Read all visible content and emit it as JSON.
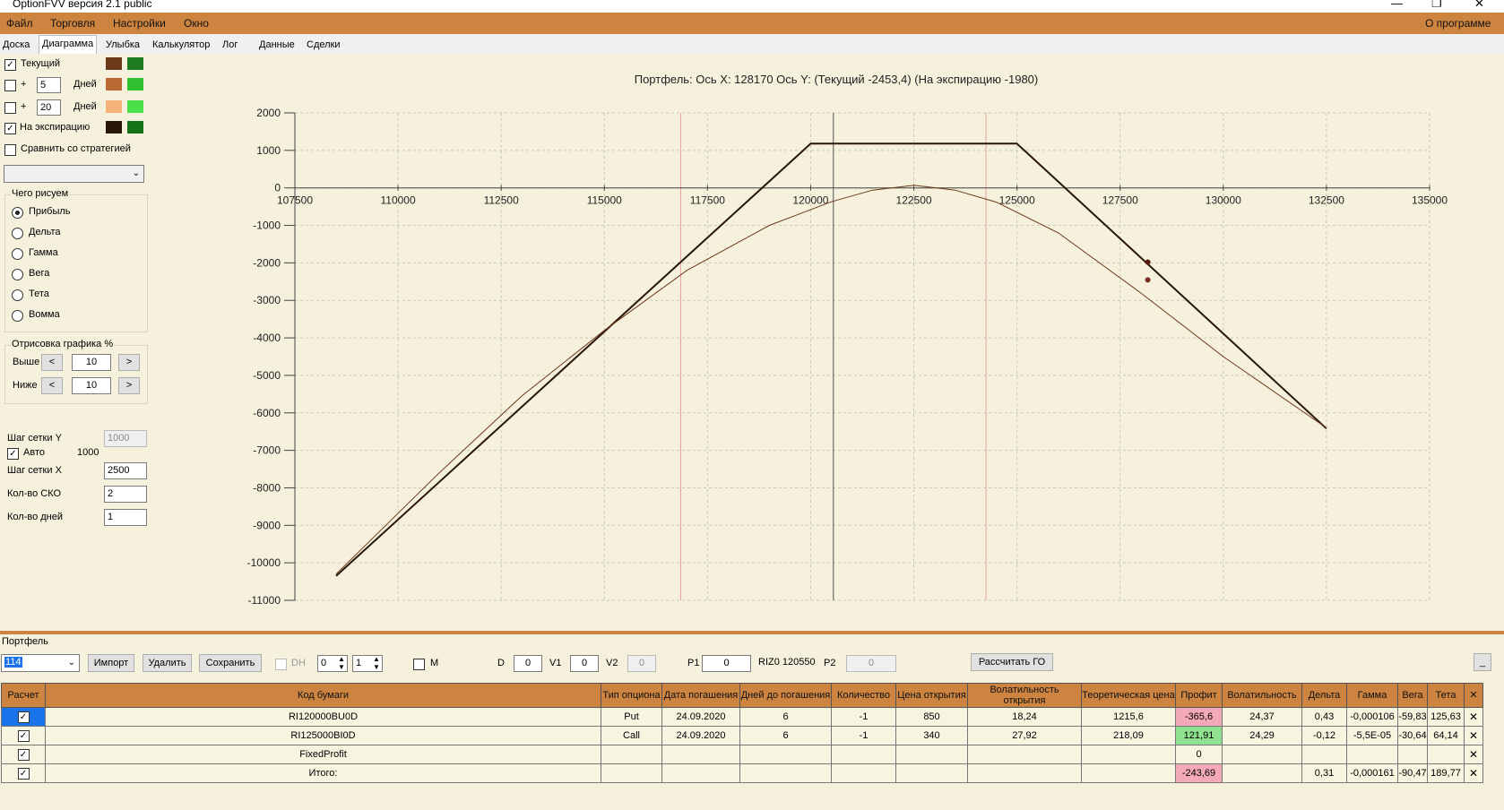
{
  "window": {
    "title": "OptionFVV версия 2.1 public",
    "controls": [
      "—",
      "❐",
      "✕"
    ]
  },
  "menu": {
    "items": [
      "Файл",
      "Торговля",
      "Настройки",
      "Окно"
    ],
    "about": "О программе"
  },
  "tabs": [
    "Доска",
    "Диаграмма",
    "Улыбка",
    "Калькулятор",
    "Лог",
    "Данные",
    "Сделки"
  ],
  "active_tab": "Диаграмма",
  "left_panel": {
    "current_label": "Текущий",
    "current_checked": true,
    "plus_label": "+",
    "days_label": "Дней",
    "days1_value": "5",
    "days1_checked": false,
    "days2_value": "20",
    "days2_checked": false,
    "expiry_label": "На экспирацию",
    "expiry_checked": true,
    "compare_label": "Сравнить со стратегией",
    "compare_checked": false,
    "compare_select": "",
    "swatches": {
      "current": [
        "#6b3a1a",
        "#1e7b1e"
      ],
      "days1": [
        "#b86a32",
        "#2fc02f"
      ],
      "days2": [
        "#f4b37a",
        "#4ae04a"
      ],
      "expiry": [
        "#2a1608",
        "#177317"
      ]
    },
    "draw_group": {
      "title": "Чего рисуем",
      "options": [
        "Прибыль",
        "Дельта",
        "Гамма",
        "Вега",
        "Тета",
        "Вомма"
      ],
      "selected": "Прибыль"
    },
    "render_group": {
      "title": "Отрисовка графика %",
      "above_label": "Выше",
      "above_value": "10",
      "below_label": "Ниже",
      "below_value": "10",
      "prev": "<",
      "next": ">"
    },
    "grid_y_label": "Шаг сетки Y",
    "grid_y_value": "1000",
    "auto_label": "Авто",
    "auto_checked": true,
    "auto_value": "1000",
    "grid_x_label": "Шаг сетки X",
    "grid_x_value": "2500",
    "sko_label": "Кол-во СКО",
    "sko_value": "2",
    "days_count_label": "Кол-во дней",
    "days_count_value": "1"
  },
  "chart_data": {
    "type": "line",
    "title": "Портфель:  Ось X: 128170 Ось Y:  (Текущий -2453,4)  (На экспирацию -1980)",
    "xlabel": "",
    "ylabel": "",
    "xlim": [
      107500,
      135000
    ],
    "ylim": [
      -11000,
      2000
    ],
    "xticks": [
      107500,
      110000,
      112500,
      115000,
      117500,
      120000,
      122500,
      125000,
      127500,
      130000,
      132500,
      135000
    ],
    "yticks": [
      2000,
      1000,
      0,
      -1000,
      -2000,
      -3000,
      -4000,
      -5000,
      -6000,
      -7000,
      -8000,
      -9000,
      -10000,
      -11000
    ],
    "grid": true,
    "vlines": [
      {
        "x": 116850,
        "color": "#e8a0a0"
      },
      {
        "x": 120550,
        "color": "#555555"
      },
      {
        "x": 124250,
        "color": "#e8a0a0"
      }
    ],
    "series": [
      {
        "color": "#2a1608",
        "width": 2,
        "x": [
          108500,
          120000,
          125000,
          132500
        ],
        "y": [
          -10350,
          1180,
          1180,
          -6420
        ]
      },
      {
        "color": "#6b3a1a",
        "width": 1,
        "x": [
          108500,
          111000,
          113000,
          115000,
          117000,
          119000,
          120500,
          121500,
          122500,
          123500,
          124500,
          126000,
          128000,
          130000,
          132500
        ],
        "y": [
          -10300,
          -7600,
          -5550,
          -3800,
          -2200,
          -1000,
          -370,
          -60,
          70,
          -60,
          -380,
          -1200,
          -2800,
          -4500,
          -6400
        ]
      }
    ],
    "markers": [
      {
        "x": 128170,
        "y": -1980,
        "color": "#5a1a10"
      },
      {
        "x": 128170,
        "y": -2453.4,
        "color": "#7a3020"
      }
    ]
  },
  "portfolio": {
    "title": "Портфель",
    "select_value": "114",
    "import_label": "Импорт",
    "delete_label": "Удалить",
    "save_label": "Сохранить",
    "dh_label": "DH",
    "spin1": "0",
    "spin2": "1",
    "m_label": "M",
    "d_label": "D",
    "d_value": "0",
    "v1_label": "V1",
    "v1_value": "0",
    "v2_label": "V2",
    "v2_value": "0",
    "p1_label": "P1",
    "p1_value": "0",
    "instrument_label": "RIZ0 120550",
    "p2_label": "P2",
    "p2_value": "0",
    "calc_go_label": "Рассчитать ГО",
    "minimize_label": "_"
  },
  "table": {
    "headers": [
      "Расчет",
      "Код бумаги",
      "Тип опциона",
      "Дата погашения",
      "Дней до погашения",
      "Количество",
      "Цена открытия",
      "Волатильность открытия",
      "Теоретическая цена",
      "Профит",
      "Волатильность",
      "Дельта",
      "Гамма",
      "Вега",
      "Тета",
      "✕"
    ],
    "rows": [
      {
        "checked": true,
        "code": "RI120000BU0D",
        "type": "Put",
        "date": "24.09.2020",
        "days": "6",
        "qty": "-1",
        "price": "850",
        "vol_open": "18,24",
        "theo": "1215,6",
        "profit": "-365,6",
        "vol": "24,37",
        "delta": "0,43",
        "gamma": "-0,000106",
        "vega": "-59,83",
        "theta": "125,63",
        "x": "✕",
        "profit_state": "neg",
        "selected": true
      },
      {
        "checked": true,
        "code": "RI125000BI0D",
        "type": "Call",
        "date": "24.09.2020",
        "days": "6",
        "qty": "-1",
        "price": "340",
        "vol_open": "27,92",
        "theo": "218,09",
        "profit": "121,91",
        "vol": "24,29",
        "delta": "-0,12",
        "gamma": "-5,5E-05",
        "vega": "-30,64",
        "theta": "64,14",
        "x": "✕",
        "profit_state": "pos",
        "selected": false
      },
      {
        "checked": true,
        "code": "FixedProfit",
        "type": "",
        "date": "",
        "days": "",
        "qty": "",
        "price": "",
        "vol_open": "",
        "theo": "",
        "profit": "0",
        "vol": "",
        "delta": "",
        "gamma": "",
        "vega": "",
        "theta": "",
        "x": "✕",
        "profit_state": "",
        "selected": false
      },
      {
        "checked": true,
        "code": "Итого:",
        "type": "",
        "date": "",
        "days": "",
        "qty": "",
        "price": "",
        "vol_open": "",
        "theo": "",
        "profit": "-243,69",
        "vol": "",
        "delta": "0,31",
        "gamma": "-0,000161",
        "vega": "-90,47",
        "theta": "189,77",
        "x": "✕",
        "profit_state": "neg",
        "selected": false
      }
    ]
  }
}
